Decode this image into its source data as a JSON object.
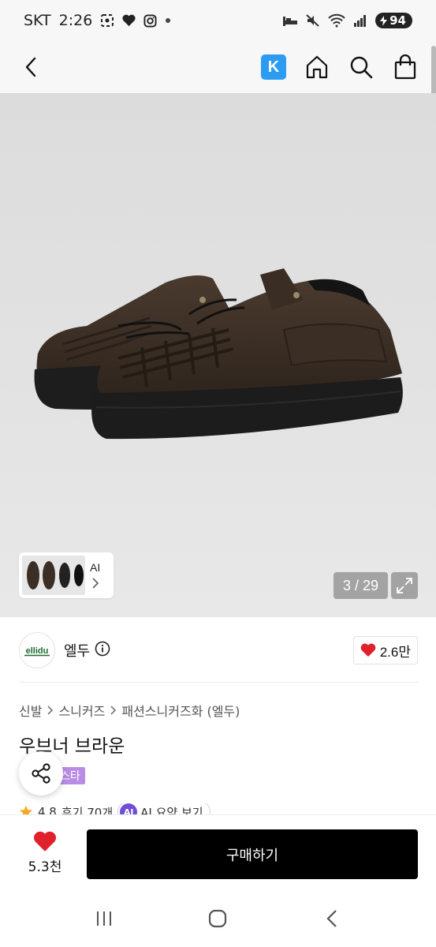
{
  "status_bar": {
    "carrier": "SKT",
    "time": "2:26",
    "battery": "94",
    "icons": [
      "screenshot-icon",
      "heart-icon",
      "instagram-icon",
      "dot-icon",
      "sleep-icon",
      "mute-icon",
      "wifi-icon",
      "signal-icon",
      "battery-icon"
    ]
  },
  "nav": {
    "back_icon": "chevron-left-icon",
    "k_label": "K",
    "k_color": "#2b9cf2",
    "home_icon": "home-icon",
    "search_icon": "search-icon",
    "bag_icon": "bag-icon"
  },
  "gallery": {
    "thumb_label": "AI",
    "counter": "3 / 29"
  },
  "brand": {
    "logo_text": "ellidu",
    "logo_color": "#1f6b2f",
    "name": "엘두",
    "likes": "2.6만",
    "heart_color": "#e0202a"
  },
  "product": {
    "breadcrumb": [
      "신발",
      "스니커즈",
      "패션스니커즈화 (엘두)"
    ],
    "title": "우브너 브라운",
    "tag": "스타",
    "rating": "4.8",
    "reviews": "후기 70개",
    "ai_label": "AI 요약 보기",
    "ai_badge": "AI"
  },
  "bottom": {
    "wish_count": "5.3천",
    "buy_label": "구매하기"
  },
  "system_nav": [
    "recents-icon",
    "home-circle-icon",
    "back-icon"
  ]
}
